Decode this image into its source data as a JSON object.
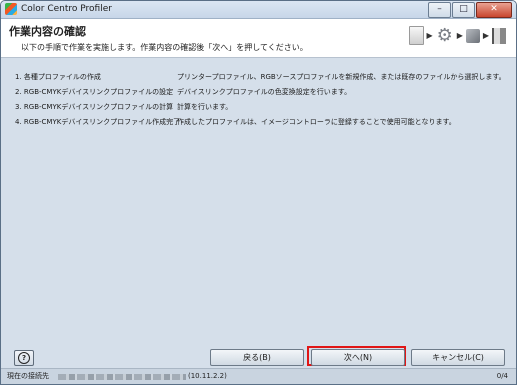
{
  "window": {
    "title": "Color Centro Profiler"
  },
  "header": {
    "title": "作業内容の確認",
    "subtitle": "以下の手順で作業を実施します。作業内容の確認後「次へ」を押してください。"
  },
  "steps_icons": [
    "document-icon",
    "gear-icon",
    "box-icon",
    "flag-icon"
  ],
  "tasks": [
    {
      "label": "1. 各種プロファイルの作成",
      "desc": "プリンタープロファイル、RGBソースプロファイルを新規作成、または既存のファイルから選択します。"
    },
    {
      "label": "2. RGB-CMYKデバイスリンクプロファイルの設定",
      "desc": "デバイスリンクプロファイルの色変換設定を行います。"
    },
    {
      "label": "3. RGB-CMYKデバイスリンクプロファイルの計算",
      "desc": "計算を行います。"
    },
    {
      "label": "4. RGB-CMYKデバイスリンクプロファイル作成完了",
      "desc": "作成したプロファイルは、イメージコントローラに登録することで使用可能となります。"
    }
  ],
  "buttons": {
    "help": "?",
    "back": "戻る(B)",
    "next": "次へ(N)",
    "cancel": "キャンセル(C)"
  },
  "status": {
    "label": "現在の接続先",
    "ip": "(10.11.2.2)",
    "count": "0/4"
  },
  "colors": {
    "highlight": "#e01616",
    "background": "#d5dfea"
  }
}
